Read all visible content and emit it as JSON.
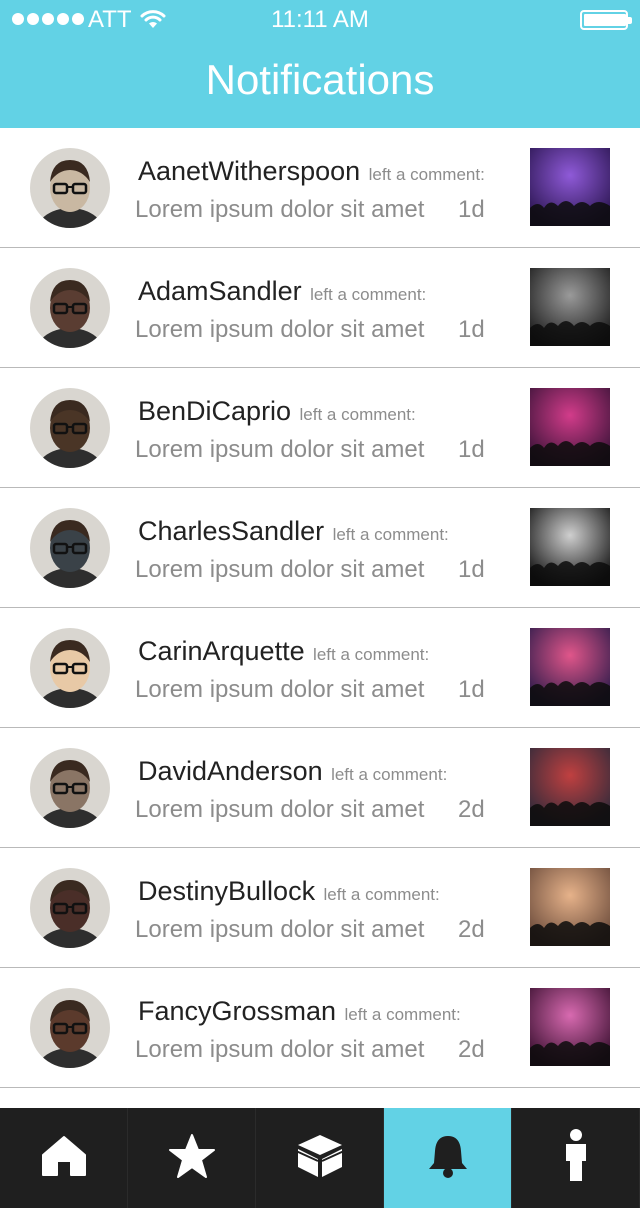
{
  "status_bar": {
    "carrier": "ATT",
    "time": "11:11 AM",
    "battery_level": 0.95
  },
  "header": {
    "title": "Notifications"
  },
  "colors": {
    "accent": "#62d2e5",
    "tabbar": "#1f1f1f",
    "active_icon": "#1f1f1f",
    "inactive_icon": "#ffffff"
  },
  "notifications": [
    {
      "user": "AanetWitherspoon",
      "action": "left a comment:",
      "message": "Lorem ipsum dolor sit amet",
      "age": "1d",
      "avatar_tone": "#c9b8a2",
      "thumb": [
        "#2a1550",
        "#8f5ad8"
      ]
    },
    {
      "user": "AdamSandler",
      "action": "left a comment:",
      "message": "Lorem ipsum dolor sit amet",
      "age": "1d",
      "avatar_tone": "#5a3d32",
      "thumb": [
        "#1a1a1a",
        "#9a9a9a"
      ]
    },
    {
      "user": "BenDiCaprio",
      "action": "left a comment:",
      "message": "Lorem ipsum dolor sit amet",
      "age": "1d",
      "avatar_tone": "#4a3526",
      "thumb": [
        "#3a1338",
        "#d23c8a"
      ]
    },
    {
      "user": "CharlesSandler",
      "action": "left a comment:",
      "message": "Lorem ipsum dolor sit amet",
      "age": "1d",
      "avatar_tone": "#3a4248",
      "thumb": [
        "#111111",
        "#cfcfcf"
      ]
    },
    {
      "user": "CarinArquette",
      "action": "left a comment:",
      "message": "Lorem ipsum dolor sit amet",
      "age": "1d",
      "avatar_tone": "#e8c9a6",
      "thumb": [
        "#2c1b4a",
        "#e0568a"
      ]
    },
    {
      "user": "DavidAnderson",
      "action": "left a comment:",
      "message": "Lorem ipsum dolor sit amet",
      "age": "2d",
      "avatar_tone": "#8a7565",
      "thumb": [
        "#2e2a3a",
        "#c04040"
      ]
    },
    {
      "user": "DestinyBullock",
      "action": "left a comment:",
      "message": "Lorem ipsum dolor sit amet",
      "age": "2d",
      "avatar_tone": "#4a2e28",
      "thumb": [
        "#6a4a3a",
        "#e6b28a"
      ]
    },
    {
      "user": "FancyGrossman",
      "action": "left a comment:",
      "message": "Lorem ipsum dolor sit amet",
      "age": "2d",
      "avatar_tone": "#5b3a2c",
      "thumb": [
        "#3a1030",
        "#d86ab0"
      ]
    }
  ],
  "tabs": [
    {
      "icon": "home-icon",
      "active": false
    },
    {
      "icon": "star-icon",
      "active": false
    },
    {
      "icon": "box-icon",
      "active": false
    },
    {
      "icon": "bell-icon",
      "active": true
    },
    {
      "icon": "person-icon",
      "active": false
    }
  ]
}
